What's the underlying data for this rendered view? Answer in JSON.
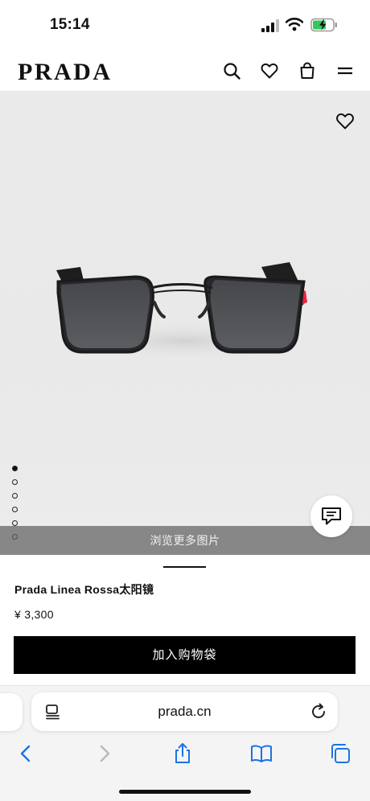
{
  "status_bar": {
    "time": "15:14"
  },
  "header": {
    "logo": "PRADA",
    "icons": [
      "search-icon",
      "heart-icon",
      "shopping-bag-icon",
      "menu-icon"
    ]
  },
  "gallery": {
    "slide_count": 6,
    "active_slide": 1,
    "browse_more": "浏览更多图片"
  },
  "product": {
    "name": "Prada Linea Rossa太阳镜",
    "price": "¥ 3,300",
    "add_to_bag": "加入购物袋"
  },
  "browser": {
    "url": "prada.cn",
    "toolbar_icons": [
      "back-icon",
      "forward-icon",
      "share-icon",
      "bookmarks-icon",
      "tabs-icon"
    ]
  },
  "colors": {
    "accent_red": "#e8263f",
    "button_black": "#000000",
    "browser_blue": "#1a73e8"
  }
}
